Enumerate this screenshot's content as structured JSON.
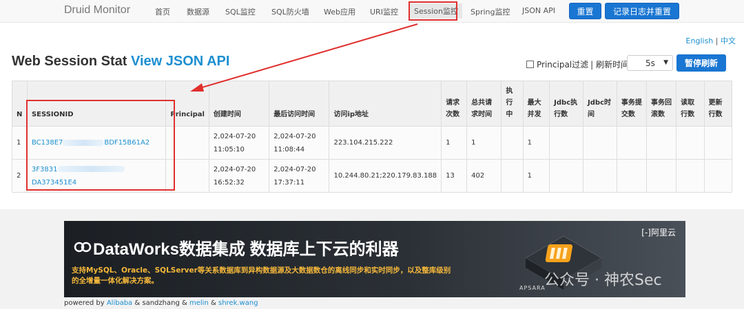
{
  "nav": {
    "brand": "Druid Monitor",
    "items": [
      "首页",
      "数据源",
      "SQL监控",
      "SQL防火墙",
      "Web应用",
      "URI监控",
      "Session监控",
      "Spring监控",
      "JSON API"
    ],
    "reset_label": "重置",
    "log_reset_label": "记录日志并重置"
  },
  "lang": {
    "en": "English",
    "sep": "|",
    "zh": "中文"
  },
  "header": {
    "title": "Web Session Stat",
    "json_link": "View JSON API",
    "principal_filter": "Principal过滤",
    "refresh_label": "| 刷新时间",
    "refresh_value": "5s",
    "pause_label": "暂停刷新"
  },
  "table": {
    "columns": [
      "N",
      "SESSIONID",
      "Principal",
      "创建时间",
      "最后访问时间",
      "访问ip地址",
      "请求次数",
      "总共请求时间",
      "执行中",
      "最大并发",
      "Jdbc执行数",
      "Jdbc时间",
      "事务提交数",
      "事务回滚数",
      "读取行数",
      "更新行数"
    ],
    "rows": [
      {
        "n": "1",
        "sid_prefix": "BC138E7",
        "sid_suffix": "BDF15B61A2",
        "principal": "",
        "created": "2,024-07-20 11:05:10",
        "last": "2,024-07-20 11:08:44",
        "ip": "223.104.215.222",
        "req": "1",
        "total": "1",
        "running": "",
        "maxc": "1"
      },
      {
        "n": "2",
        "sid_prefix": "3F3831",
        "sid_suffix": "DA373451E4",
        "principal": "",
        "created": "2,024-07-20 16:52:32",
        "last": "2,024-07-20 17:37:11",
        "ip": "10.244.80.21;220.179.83.188",
        "req": "13",
        "total": "402",
        "running": "",
        "maxc": "1"
      }
    ]
  },
  "banner": {
    "title": "DataWorks数据集成 数据库上下云的利器",
    "desc": "支持MySQL、Oracle、SQLServer等关系数据库到异构数据源及大数据数仓的离线同步和实时同步，以及整库级别的全增量一体化解决方案。",
    "brand": "[-]阿里云",
    "apsara": "APSARA",
    "watermark": "公众号 · 神农Sec"
  },
  "footer": {
    "powered": "powered by",
    "alibaba": "Alibaba",
    "amp1": "&",
    "sandzhang": "sandzhang",
    "amp2": "&",
    "melin": "melin",
    "amp3": "&",
    "shrek": "shrek.wang"
  }
}
